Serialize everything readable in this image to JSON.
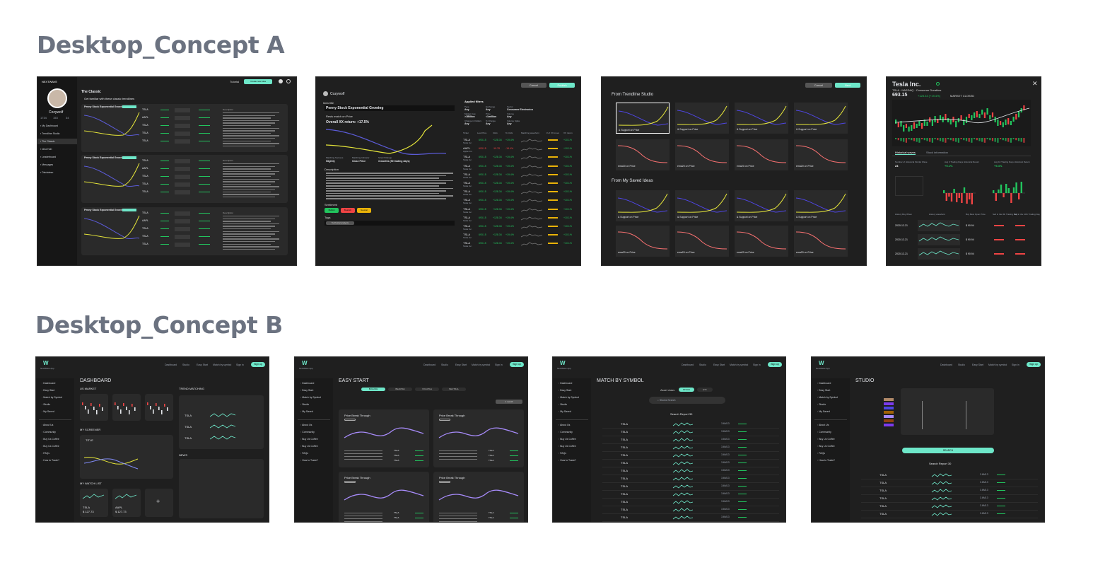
{
  "concept_a": {
    "title": "Desktop_Concept A",
    "screen1": {
      "brand": "NEXTWAVE",
      "tutorial": "Tutorial",
      "create": "Create new idea",
      "user": "Cozywolf",
      "stats": [
        "1734",
        "153",
        "34"
      ],
      "nav": [
        "My Dashboard",
        "Trendline Studio",
        "The Classic",
        "Idea Hub",
        "Leaderboard",
        "Messages",
        "Disclaimer"
      ],
      "heading": "The Classic",
      "subheading": "Get familiar with these classic trendlines",
      "card_title": "Penny Stock Exponential Growing",
      "tickers": [
        "TSLA",
        "AAPL",
        "TSLA",
        "TSLA",
        "TSLA"
      ],
      "description_label": "Description"
    },
    "screen2": {
      "cancel": "Cancel",
      "publish": "Publish",
      "user": "Cozywolf",
      "idea_title_label": "Idea title",
      "idea_title": "Penny Stock Exponential Growing",
      "match_text": "Resis match on Price",
      "overall": "Overall XX return: +17.5%",
      "applied_filters": "Applied filters",
      "filter_labels": [
        "Type",
        "Exchange",
        "Sector",
        "Market Cap",
        "Price",
        "Volume",
        "Change in Dollars",
        "% Change",
        "Volume Spike"
      ],
      "filter_values": [
        "Any",
        "Any",
        "Consumer Electronics",
        ">1Billion",
        "<1million",
        "Any",
        "Any",
        "Any",
        "Any"
      ],
      "footer": [
        "Matching Success",
        "Matching Indicator",
        "Stretch Range"
      ],
      "footer_vals": [
        "Slightly",
        "Close Price",
        "3 months (50 trading days)"
      ],
      "description_label": "Description",
      "sentiment_label": "Sentiment",
      "sentiments": [
        "Bullish",
        "Bearish",
        "Neutral"
      ],
      "tags_label": "Tags",
      "tag": "Technical analysis",
      "table_headers": [
        "Ticker",
        "Last Price",
        "CHG",
        "% CHG",
        "Matching waveform",
        "# of XX move",
        "XX return"
      ],
      "rows": [
        {
          "ticker": "TSLA",
          "name": "Tesla Inc.",
          "price": "693.15",
          "chg": "+128.34",
          "pct": "+19.4%",
          "ret": "+10.1%"
        },
        {
          "ticker": "AAPL",
          "name": "Apple Inc.",
          "price": "693.15",
          "chg": "-19.78",
          "pct": "-19.4%",
          "ret": "+10.1%"
        },
        {
          "ticker": "TSLA",
          "name": "Tesla Inc.",
          "price": "693.15",
          "chg": "+128.34",
          "pct": "+19.4%",
          "ret": "+10.1%"
        },
        {
          "ticker": "TSLA",
          "name": "Tesla Inc.",
          "price": "693.15",
          "chg": "+128.34",
          "pct": "+19.4%",
          "ret": "+10.1%"
        },
        {
          "ticker": "TSLA",
          "name": "Tesla Inc.",
          "price": "693.15",
          "chg": "+128.34",
          "pct": "+19.4%",
          "ret": "+10.1%"
        },
        {
          "ticker": "TSLA",
          "name": "Tesla Inc.",
          "price": "693.15",
          "chg": "+128.34",
          "pct": "+19.4%",
          "ret": "+10.1%"
        },
        {
          "ticker": "TSLA",
          "name": "Tesla Inc.",
          "price": "693.15",
          "chg": "+128.34",
          "pct": "+19.4%",
          "ret": "+10.1%"
        },
        {
          "ticker": "TSLA",
          "name": "Tesla Inc.",
          "price": "693.15",
          "chg": "+128.34",
          "pct": "+19.4%",
          "ret": "+10.1%"
        },
        {
          "ticker": "TSLA",
          "name": "Tesla Inc.",
          "price": "693.15",
          "chg": "+128.34",
          "pct": "+19.4%",
          "ret": "+10.1%"
        },
        {
          "ticker": "TSLA",
          "name": "Tesla Inc.",
          "price": "693.15",
          "chg": "+128.34",
          "pct": "+19.4%",
          "ret": "+10.1%"
        },
        {
          "ticker": "TSLA",
          "name": "Tesla Inc.",
          "price": "693.15",
          "chg": "+128.34",
          "pct": "+19.4%",
          "ret": "+10.1%"
        },
        {
          "ticker": "TSLA",
          "name": "Tesla Inc.",
          "price": "693.15",
          "chg": "+128.34",
          "pct": "+19.4%",
          "ret": "+10.1%"
        },
        {
          "ticker": "TSLA",
          "name": "Tesla Inc.",
          "price": "693.15",
          "chg": "+128.34",
          "pct": "+19.4%",
          "ret": "+10.1%"
        }
      ]
    },
    "screen3": {
      "cancel": "Cancel",
      "next": "Next",
      "from_studio": "From Trendline Studio",
      "from_saved": "From My Saved Ideas",
      "tile_yellow": "& Support on Price",
      "tile_red": "ema20 on Price"
    },
    "screen4": {
      "title": "Tesla Inc.",
      "subtitle": "TSLA · NASDAQ · Consumer Durables",
      "price": "693.15",
      "change": "+128.34 (+19.4%)",
      "market": "MARKET CLOSED",
      "tabs": [
        "Historical waves",
        "Stock information"
      ],
      "stats": [
        "Number of Historical Similar Wave",
        "Avg 3 Trading Days Historical Return",
        "Avg 10 Trading Days Historical Return"
      ],
      "stat_vals": [
        "24",
        "+9.1%",
        "+9.4%"
      ],
      "history_headers": [
        "History Buy When",
        "History waveform",
        "Buy Best Open Price",
        "Sell in the 3th Trading Day",
        "Sell in the 10th Trading Day"
      ],
      "dates": [
        "2020-12-21",
        "2020-12-21",
        "2020-12-21"
      ],
      "buy_price": "$ 90.94"
    }
  },
  "concept_b": {
    "title": "Desktop_Concept B",
    "brand": "NextWave App",
    "top_nav": [
      "Dashboard",
      "Studio",
      "Easy Start",
      "Match by symbol",
      "Sign in"
    ],
    "signup": "Sign up",
    "side_nav": [
      "Dashboard",
      "Easy Start",
      "Match by Symbol",
      "Studio",
      "My Saved"
    ],
    "side_nav2": [
      "About Us",
      "Community",
      "Buy Us Coffee",
      "Buy Us Coffee",
      "FAQs",
      "How to Trade?"
    ],
    "dashboard": {
      "heading": "DASHBOARD",
      "us_market": "US MARKET",
      "screener": "MY SCREENER",
      "watch_list": "MY WATCH LIST",
      "trend_matching": "TREND MATCHING",
      "news": "NEWS",
      "screener_ticker": "TITLE",
      "watch": [
        {
          "t": "TSLA",
          "p": "$ 127.73"
        },
        {
          "t": "AAPL",
          "p": "$ 127.73"
        }
      ],
      "trend_rows": [
        "TSLA",
        "TSLA",
        "TSLA"
      ],
      "add": "+"
    },
    "easy_start": {
      "heading": "EASY START",
      "chips": [
        "BULLISH",
        "BEARISH",
        "VOLATILE",
        "NEUTRAL"
      ],
      "period": "1 month",
      "card_title": "Price Break Through"
    },
    "match": {
      "heading": "MATCH BY SYMBOL",
      "asset_class": "Asset class",
      "asset_options": [
        "STOCK",
        "ETF"
      ],
      "search_placeholder": "Stocks Search",
      "report": "Search Report 30",
      "ticker": "TSLA",
      "price": "3.6M13"
    },
    "studio": {
      "heading": "STUDIO",
      "search": "SEARCH",
      "report": "Search Report 30",
      "ticker": "TSLA",
      "price": "3.6M13"
    }
  }
}
